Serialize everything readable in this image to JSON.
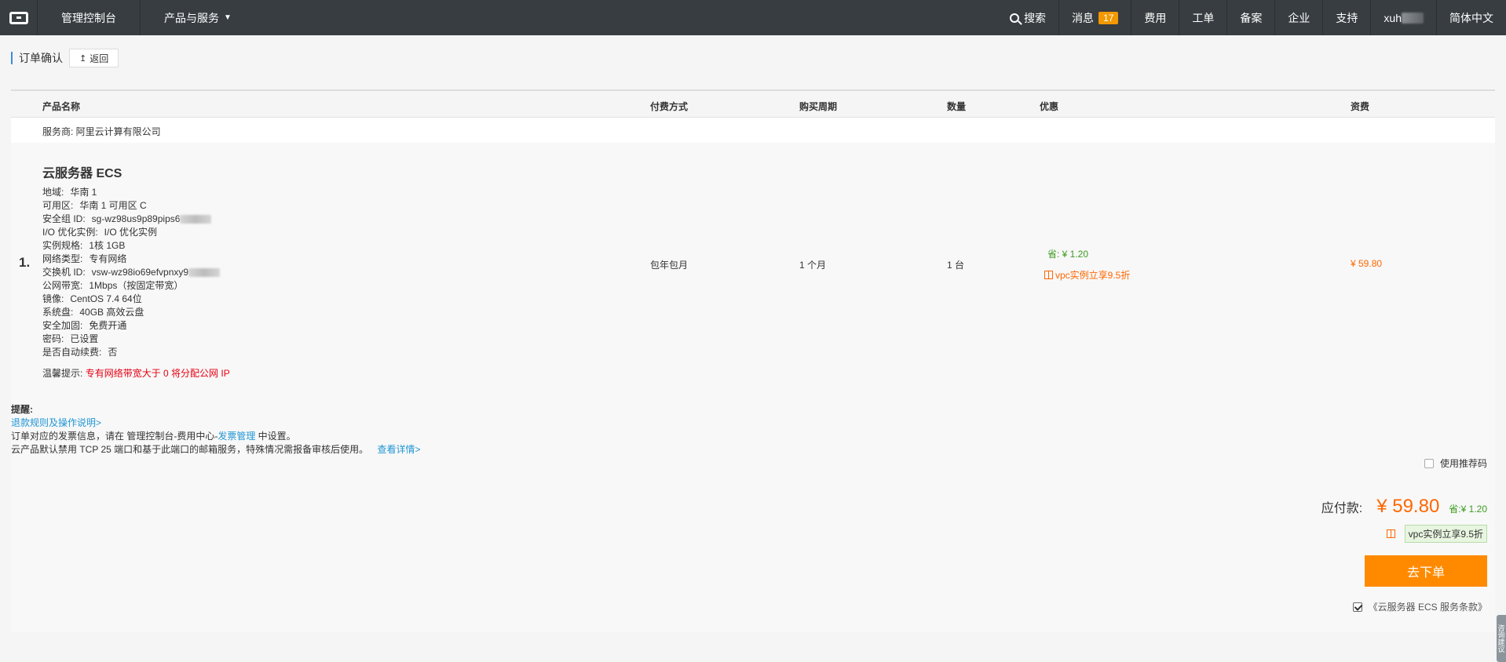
{
  "topbar": {
    "console": "管理控制台",
    "products": "产品与服务",
    "search": "搜索",
    "messages": "消息",
    "message_count": "17",
    "fees": "费用",
    "tickets": "工单",
    "icp": "备案",
    "enterprise": "企业",
    "support": "支持",
    "user": "xuh",
    "language": "简体中文"
  },
  "page": {
    "title": "订单确认",
    "back": "返回"
  },
  "table": {
    "headers": {
      "product": "产品名称",
      "payment": "付费方式",
      "period": "购买周期",
      "quantity": "数量",
      "discount": "优惠",
      "fee": "资费"
    },
    "vendor": "服务商: 阿里云计算有限公司"
  },
  "item": {
    "index": "1.",
    "name": "云服务器 ECS",
    "specs": [
      {
        "k": "地域:",
        "v": "华南 1"
      },
      {
        "k": "可用区:",
        "v": "华南 1 可用区 C"
      },
      {
        "k": "安全组 ID:",
        "v": "sg-wz98us9p89pips6"
      },
      {
        "k": "I/O 优化实例:",
        "v": "I/O 优化实例"
      },
      {
        "k": "实例规格:",
        "v": "1核 1GB"
      },
      {
        "k": "网络类型:",
        "v": "专有网络"
      },
      {
        "k": "交换机 ID:",
        "v": "vsw-wz98io69efvpnxy9"
      },
      {
        "k": "公网带宽:",
        "v": "1Mbps（按固定带宽）"
      },
      {
        "k": "镜像:",
        "v": "CentOS 7.4 64位"
      },
      {
        "k": "系统盘:",
        "v": "40GB 高效云盘"
      },
      {
        "k": "安全加固:",
        "v": "免费开通"
      },
      {
        "k": "密码:",
        "v": "已设置"
      },
      {
        "k": "是否自动续费:",
        "v": "否"
      }
    ],
    "tip_label": "温馨提示:",
    "tip_text": "专有网络带宽大于 0 将分配公网 IP",
    "payment": "包年包月",
    "period": "1 个月",
    "quantity": "1 台",
    "save": "省: ¥ 1.20",
    "promo": "vpc实例立享9.5折",
    "fee": "¥ 59.80"
  },
  "notes": {
    "title": "提醒:",
    "refund_link": "退款规则及操作说明>",
    "invoice_pre": "订单对应的发票信息，请在 管理控制台-费用中心-",
    "invoice_link": "发票管理",
    "invoice_post": " 中设置。",
    "smtp_text": "云产品默认禁用 TCP 25 端口和基于此端口的邮箱服务，特殊情况需报备审核后使用。",
    "smtp_link": "查看详情>"
  },
  "summary": {
    "use_code": "使用推荐码",
    "payable_label": "应付款:",
    "payable": "¥ 59.80",
    "save": "省:¥ 1.20",
    "promo": "vpc实例立享9.5折",
    "order_button": "去下单",
    "terms": "《云服务器 ECS 服务条款》"
  },
  "side_tab": "咨询建议"
}
